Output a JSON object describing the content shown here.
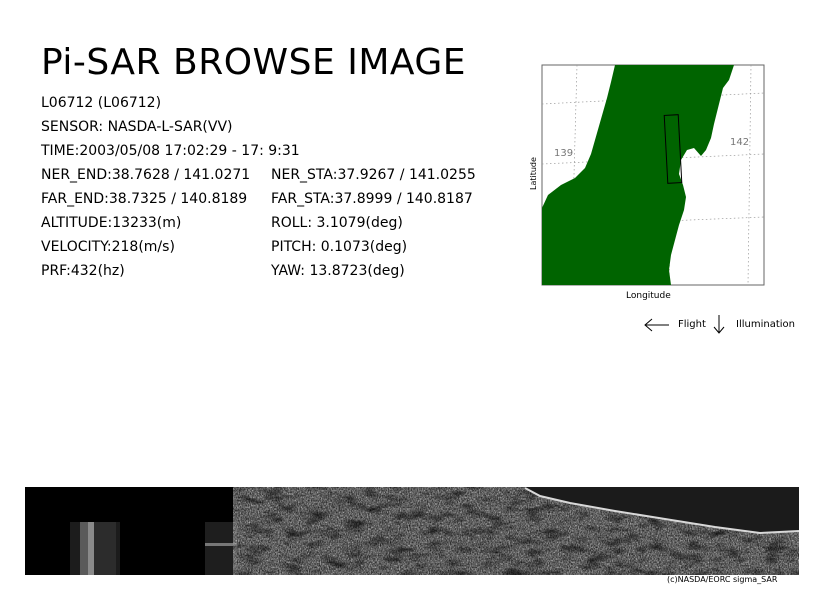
{
  "title": "Pi-SAR BROWSE IMAGE",
  "scene_id": "L06712 (L06712)",
  "sensor": "SENSOR: NASDA-L-SAR(VV)",
  "time": "TIME:2003/05/08  17:02:29 - 17: 9:31",
  "ner_end": "NER_END:38.7628 / 141.0271",
  "ner_sta": "NER_STA:37.9267 / 141.0255",
  "far_end": "FAR_END:38.7325 / 140.8189",
  "far_sta": "FAR_STA:37.8999 / 140.8187",
  "altitude": "ALTITUDE:13233(m)",
  "roll": "ROLL: 3.1079(deg)",
  "velocity": "VELOCITY:218(m/s)",
  "pitch": "PITCH:  0.1073(deg)",
  "prf": "PRF:432(hz)",
  "yaw": "YAW:  13.8723(deg)",
  "map": {
    "lon_label_left": "139",
    "lon_label_right": "142",
    "y_axis_label": "Latitude",
    "x_axis_label": "Longitude",
    "land_color": "#006400"
  },
  "legend": {
    "flight_label": "Flight",
    "illumination_label": "Illumination"
  },
  "credit": "(c)NASDA/EORC sigma_SAR"
}
